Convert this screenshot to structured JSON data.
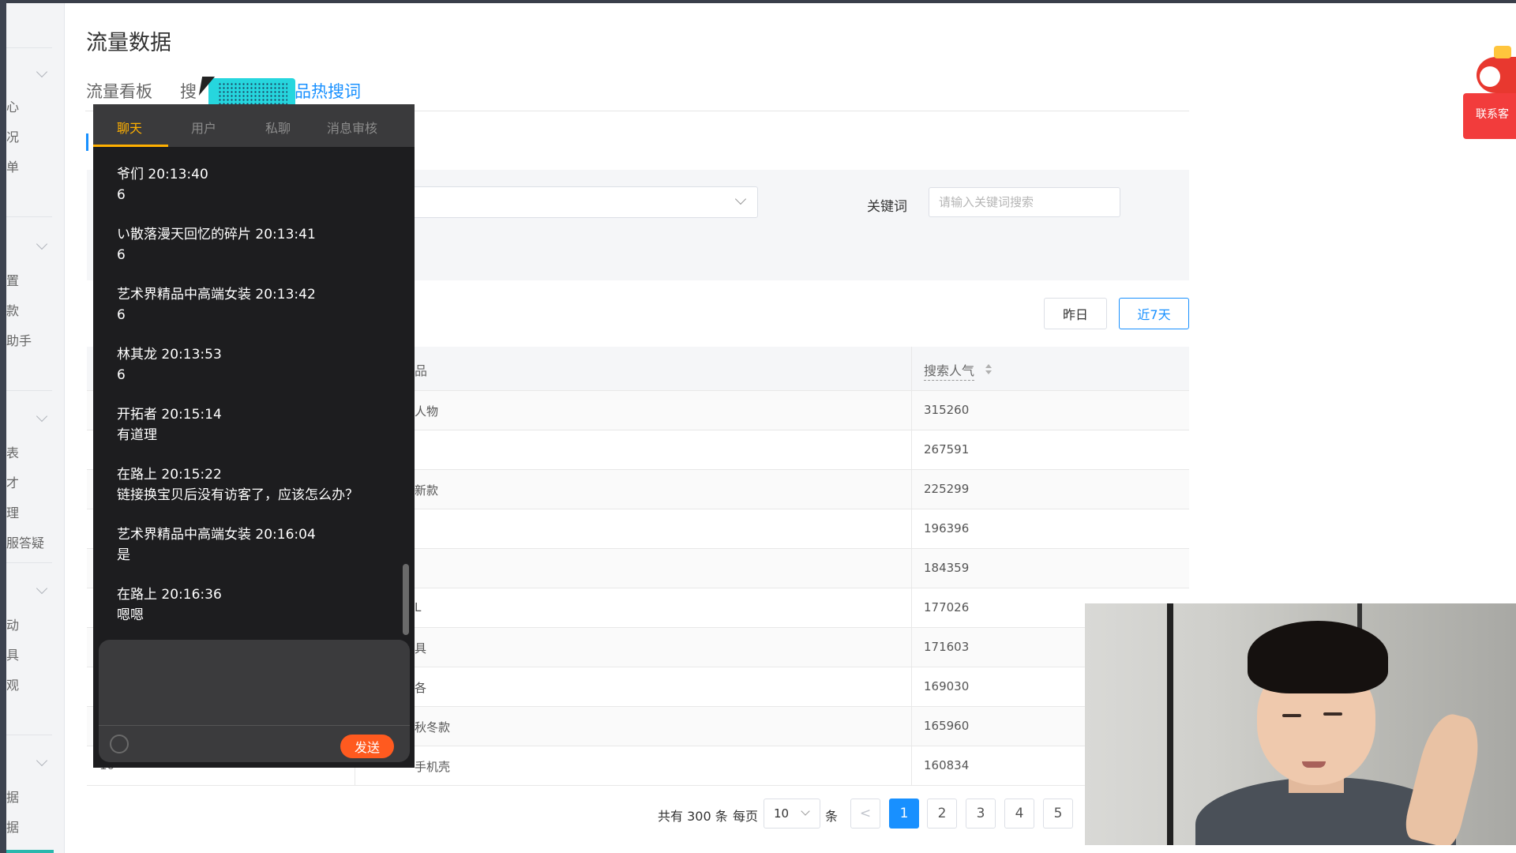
{
  "sidebar": {
    "items": [
      "心",
      "况",
      "单",
      "置",
      "款",
      "助手",
      "表",
      "才",
      "理",
      "服答疑",
      "动",
      "具",
      "观",
      "据",
      "据"
    ]
  },
  "page": {
    "title": "流量数据",
    "tabs": [
      "流量看板",
      "搜",
      "品热搜词"
    ]
  },
  "filters": {
    "keyword_label": "关键词",
    "keyword_placeholder": "请输入关键词搜索",
    "keyword_value": ""
  },
  "date_buttons": {
    "yesterday": "昨日",
    "last7": "近7天"
  },
  "table": {
    "header_name": "品",
    "header_popularity": "搜索人气",
    "rows": [
      {
        "rank": "",
        "name": "人物",
        "pop": "315260"
      },
      {
        "rank": "",
        "name": "",
        "pop": "267591"
      },
      {
        "rank": "",
        "name": "新款",
        "pop": "225299"
      },
      {
        "rank": "",
        "name": "",
        "pop": "196396"
      },
      {
        "rank": "",
        "name": "",
        "pop": "184359"
      },
      {
        "rank": "",
        "name": "L",
        "pop": "177026"
      },
      {
        "rank": "",
        "name": "具",
        "pop": "171603"
      },
      {
        "rank": "",
        "name": "各",
        "pop": "169030"
      },
      {
        "rank": "",
        "name": "秋冬款",
        "pop": "165960"
      },
      {
        "rank": "10",
        "name": "手机壳",
        "pop": "160834"
      }
    ]
  },
  "pagination": {
    "total": "共有 300 条",
    "per_page_label": "每页",
    "page_size": "10",
    "unit": "条",
    "prev": "<",
    "pages": [
      "1",
      "2",
      "3",
      "4",
      "5"
    ]
  },
  "chat": {
    "tabs": [
      "聊天",
      "用户",
      "私聊",
      "消息审核"
    ],
    "messages": [
      {
        "header": "爷们 20:13:40",
        "body": "6"
      },
      {
        "header": "い散落漫天回忆的碎片 20:13:41",
        "body": "6"
      },
      {
        "header": "艺术界精品中高端女装 20:13:42",
        "body": "6"
      },
      {
        "header": "林其龙 20:13:53",
        "body": "6"
      },
      {
        "header": "开拓者 20:15:14",
        "body": "有道理"
      },
      {
        "header": "在路上 20:15:22",
        "body": "链接换宝贝后没有访客了，应该怎么办？"
      },
      {
        "header": "艺术界精品中高端女装 20:16:04",
        "body": "是"
      },
      {
        "header": "在路上 20:16:36",
        "body": "嗯嗯"
      }
    ],
    "send_label": "发送"
  },
  "contact": {
    "label": "联系客"
  },
  "colors": {
    "accent": "#1890ff",
    "chat_tab_active": "#ffb000",
    "send_button": "#ff5a1f",
    "contact_badge": "#f23c3c"
  }
}
